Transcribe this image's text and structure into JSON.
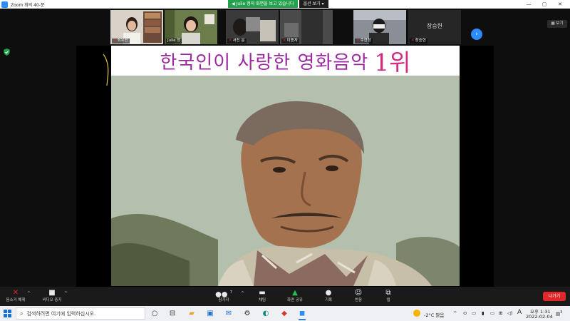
{
  "window": {
    "title": "Zoom 회의 40-분",
    "minimize": "—",
    "maximize": "▢",
    "close": "✕"
  },
  "share_banner": {
    "viewing_text": "Julie 정의 화면을 보고 있습니다",
    "options_label": "옵션 보기 ▾"
  },
  "participants": [
    {
      "name": "최우신",
      "muted": true,
      "bg": "#d8d2c8"
    },
    {
      "name": "Julie 정",
      "muted": false,
      "bg": "#6b7d4a"
    },
    {
      "name": "서진 문",
      "muted": true,
      "bg": "#3a3a3a"
    },
    {
      "name": "이종자",
      "muted": true,
      "bg": "#4a4a4a"
    },
    {
      "name": "주현정",
      "muted": true,
      "bg": "#8a8f96"
    },
    {
      "name": "장승헌",
      "muted": true,
      "bg": "#262626"
    }
  ],
  "strip_view_button": "보기",
  "slide": {
    "title": "한국인이 사랑한 영화음악",
    "rank": "1위"
  },
  "toolbar": {
    "mute": "음소거 해제",
    "video": "비디오 중지",
    "participants": "참가자",
    "participants_count": "7",
    "chat": "채팅",
    "share": "화면 공유",
    "record": "기록",
    "reactions": "반응",
    "apps": "앱",
    "leave": "나가기"
  },
  "taskbar": {
    "search_placeholder": "검색하려면 여기에 입력하십시오.",
    "weather": "-2°C 맑음",
    "ime": "A",
    "time": "오후 1:31",
    "date": "2022-02-04",
    "notifications": "3"
  },
  "colors": {
    "zoom_blue": "#2d8cff",
    "share_green": "#23a24d",
    "leave_red": "#e02828",
    "title_purple": "#9b2aa0",
    "rank_pink": "#d32a82"
  }
}
